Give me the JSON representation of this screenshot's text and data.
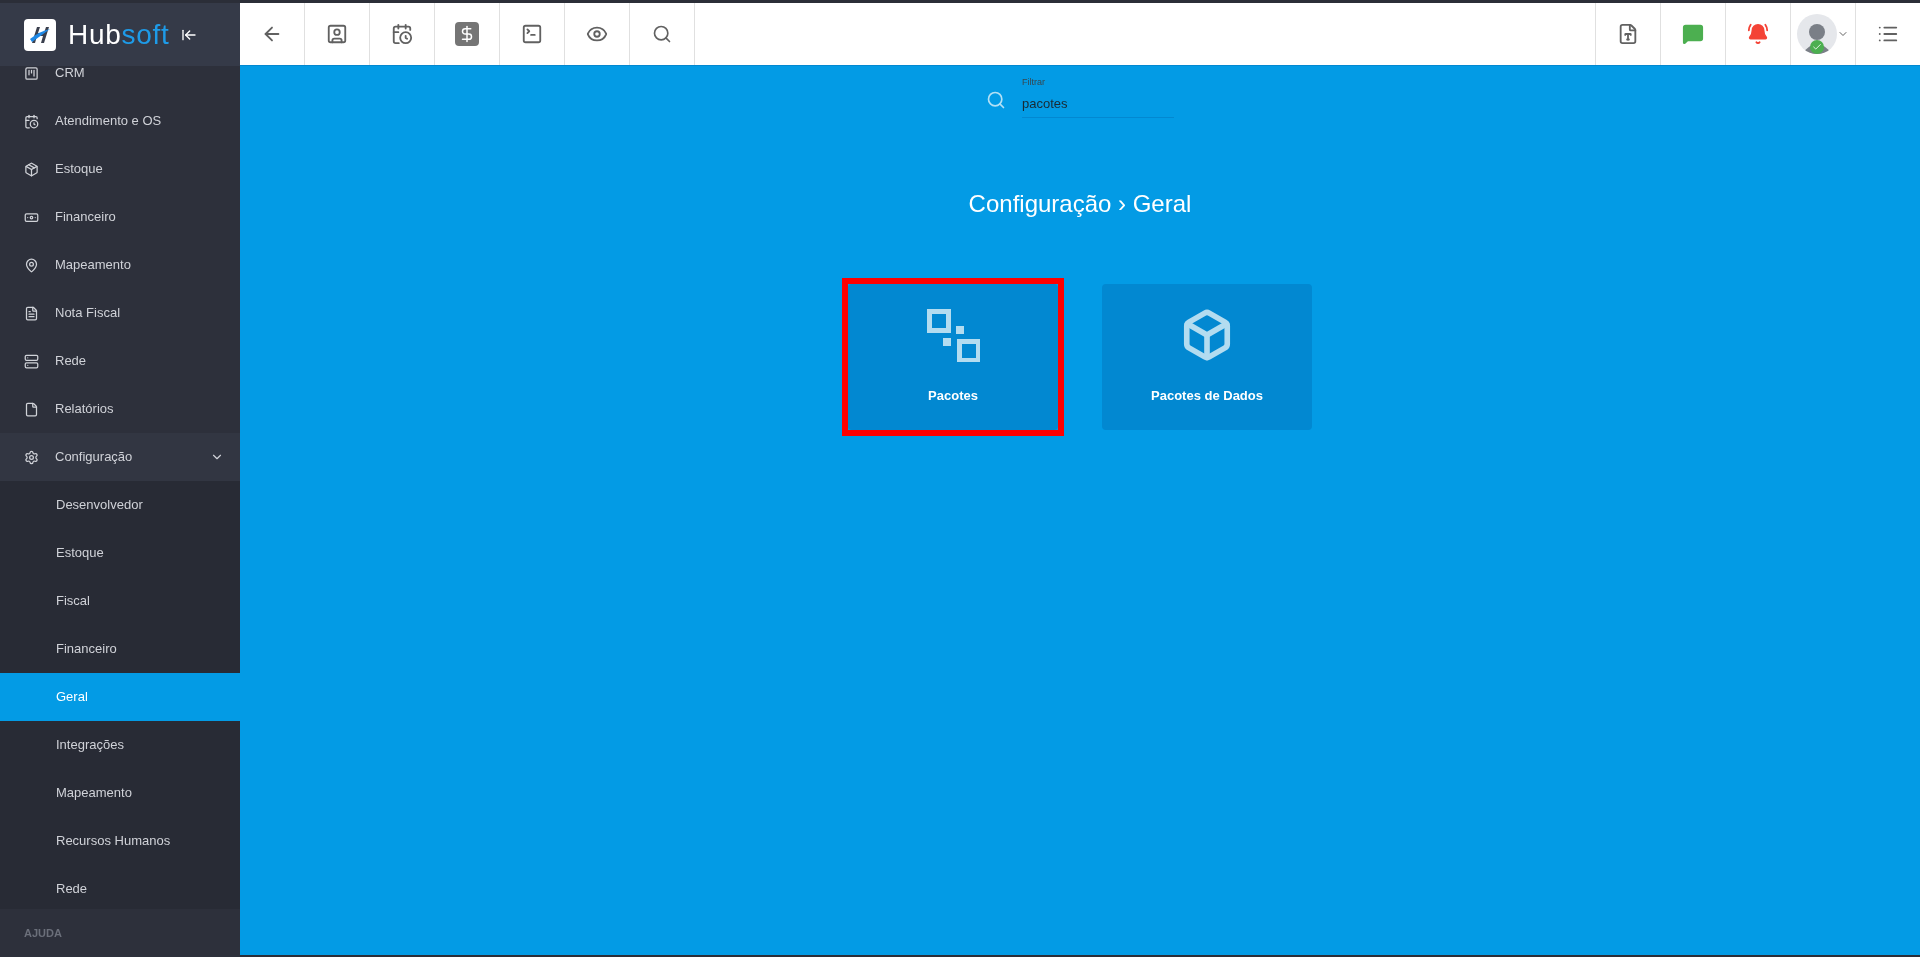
{
  "logo": {
    "main": "Hub",
    "accent": "soft"
  },
  "sidebar": {
    "items": [
      {
        "label": "CRM",
        "selected": false
      },
      {
        "label": "Atendimento e OS",
        "selected": false
      },
      {
        "label": "Estoque",
        "selected": false
      },
      {
        "label": "Financeiro",
        "selected": false
      },
      {
        "label": "Mapeamento",
        "selected": false
      },
      {
        "label": "Nota Fiscal",
        "selected": false
      },
      {
        "label": "Rede",
        "selected": false
      },
      {
        "label": "Relatórios",
        "selected": false
      },
      {
        "label": "Configuração",
        "selected": false,
        "expanded": true,
        "children": [
          {
            "label": "Desenvolvedor",
            "selected": false
          },
          {
            "label": "Estoque",
            "selected": false
          },
          {
            "label": "Fiscal",
            "selected": false
          },
          {
            "label": "Financeiro",
            "selected": false
          },
          {
            "label": "Geral",
            "selected": true
          },
          {
            "label": "Integrações",
            "selected": false
          },
          {
            "label": "Mapeamento",
            "selected": false
          },
          {
            "label": "Recursos Humanos",
            "selected": false
          },
          {
            "label": "Rede",
            "selected": false
          }
        ]
      }
    ],
    "section": "AJUDA"
  },
  "filter": {
    "label": "Filtrar",
    "value": "pacotes"
  },
  "title": "Configuração › Geral",
  "cards": [
    {
      "label": "Pacotes",
      "highlighted": true
    },
    {
      "label": "Pacotes de Dados",
      "highlighted": false
    }
  ]
}
